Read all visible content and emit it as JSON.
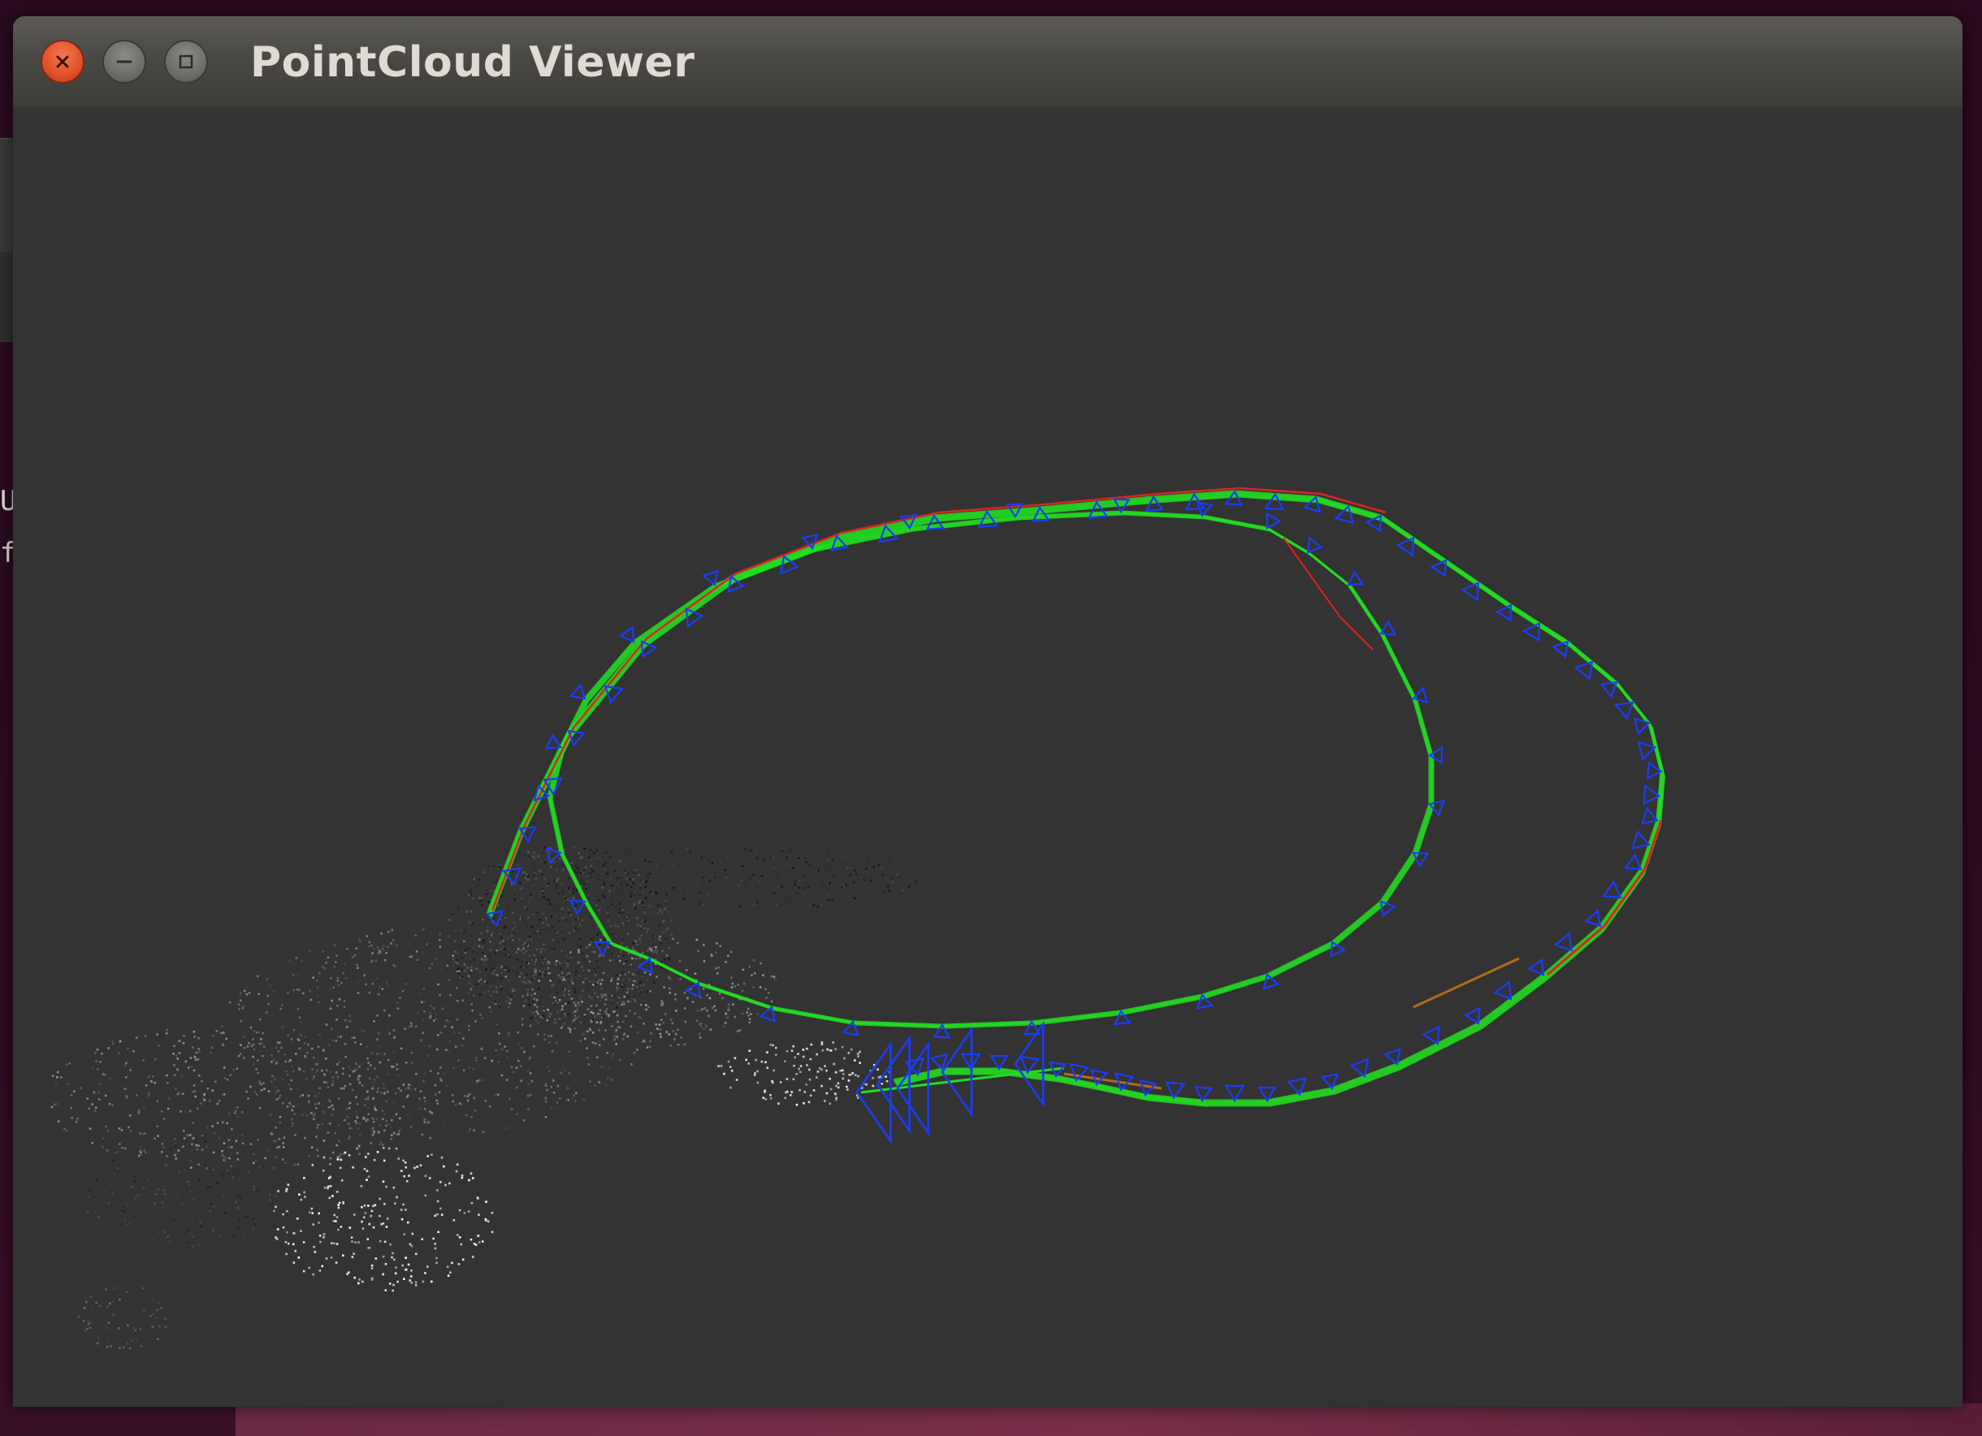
{
  "window": {
    "title": "PointCloud Viewer",
    "buttons": {
      "close_icon": "close-icon",
      "minimize_icon": "minimize-icon",
      "maximize_icon": "maximize-icon"
    }
  },
  "background_text": [
    "U",
    "f"
  ],
  "colors": {
    "viewport_background": "#333333",
    "trajectory_estimate": "#22dd22",
    "trajectory_ground_truth": "#dd2222",
    "camera_frustum": "#1a3cff",
    "loop_edge": "#b36b1a",
    "point_cloud": "#cfcfcf"
  },
  "viewport": {
    "content": "3D point cloud with camera trajectory and keyframe frustums"
  }
}
